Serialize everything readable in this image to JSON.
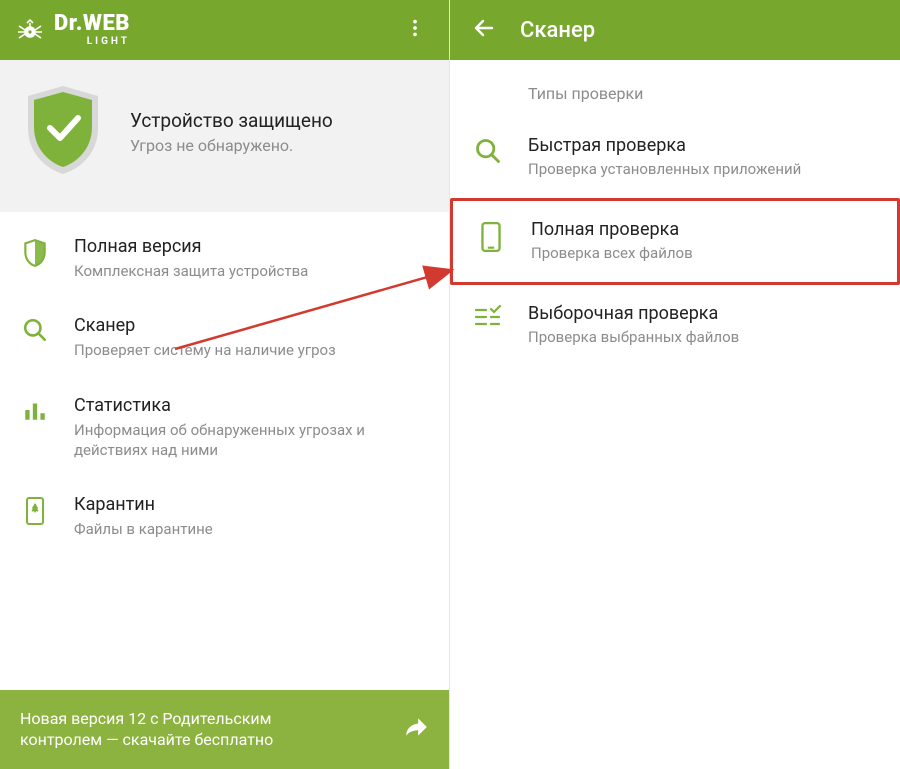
{
  "colors": {
    "primary": "#78a72d",
    "primary_light": "#8cb33f",
    "text": "#222222",
    "muted": "#8c8c8c",
    "highlight_border": "#d33a2f"
  },
  "left": {
    "brand": {
      "main": "Dr.WEB",
      "sub": "LIGHT"
    },
    "status": {
      "title": "Устройство защищено",
      "subtitle": "Угроз не обнаружено."
    },
    "menu": {
      "full_version": {
        "title": "Полная версия",
        "subtitle": "Комплексная защита устройства"
      },
      "scanner": {
        "title": "Сканер",
        "subtitle": "Проверяет систему на наличие угроз"
      },
      "stats": {
        "title": "Статистика",
        "subtitle": "Информация об обнаруженных угрозах и действиях над ними"
      },
      "quarantine": {
        "title": "Карантин",
        "subtitle": "Файлы в карантине"
      }
    },
    "footer": {
      "message": "Новая версия 12 с Родительским контролем — скачайте бесплатно"
    }
  },
  "right": {
    "title": "Сканер",
    "section_header": "Типы проверки",
    "items": {
      "quick": {
        "title": "Быстрая проверка",
        "subtitle": "Проверка установленных приложений"
      },
      "full": {
        "title": "Полная проверка",
        "subtitle": "Проверка всех файлов"
      },
      "custom": {
        "title": "Выборочная проверка",
        "subtitle": "Проверка выбранных файлов"
      }
    }
  }
}
